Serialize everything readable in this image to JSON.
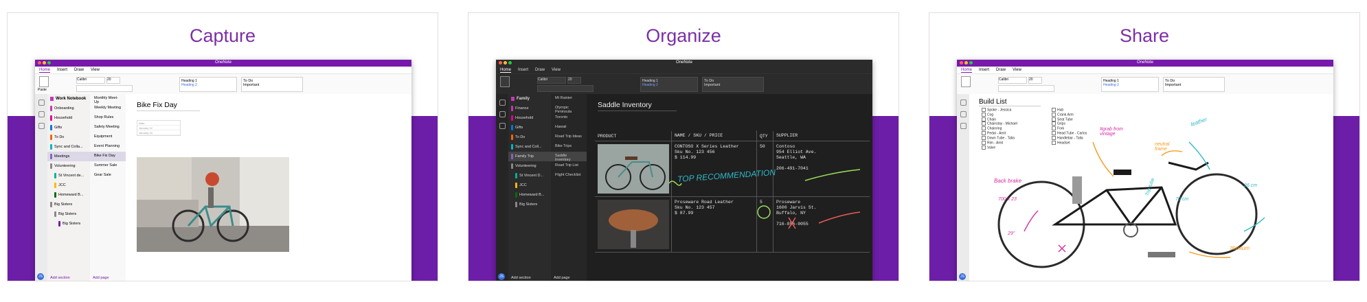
{
  "panels": [
    {
      "title": "Capture"
    },
    {
      "title": "Organize"
    },
    {
      "title": "Share"
    }
  ],
  "app": {
    "window_title": "OneNote",
    "menu": [
      "Home",
      "Insert",
      "Draw",
      "View"
    ],
    "ribbon": {
      "font": "Calibri",
      "size": "20",
      "style1": "Heading 1",
      "style2": "Heading 2",
      "tag1": "To Do",
      "tag2": "Important",
      "paste": "Paste",
      "cut": "Cut",
      "copy": "Copy",
      "format": "Format"
    },
    "add_section": "Add section",
    "add_page": "Add page",
    "avatar": "JS"
  },
  "capture": {
    "notebook": "Work Notebook",
    "sections": [
      "Onboarding",
      "Household",
      "Gifts",
      "To Do",
      "Sync and Colla...",
      "Meetings",
      "Volunteering",
      "St Vincent de...",
      "JCC",
      "Homeward B...",
      "Big Sisters",
      "Big Sisters",
      "Big Sisters"
    ],
    "section_colors": [
      "#c239b3",
      "#e3008c",
      "#0078d4",
      "#f7630c",
      "#00b7c3",
      "#8764b8",
      "#888888",
      "#00b294",
      "#ffb900",
      "#0b6a0b",
      "#888888",
      "#888888",
      "#7719aa"
    ],
    "pages": [
      "Monthly Meet-Up",
      "Weekly Meeting",
      "Shop Rules",
      "Safety Meeting",
      "Equipment",
      "Event Planning",
      "Bike Fix Day",
      "Summer Sale",
      "Gear Sale"
    ],
    "page_title": "Bike Fix Day",
    "mini_table": [
      "Date",
      "January 12",
      "January 15"
    ]
  },
  "organize": {
    "notebook": "Family",
    "sections": [
      "Finance",
      "Household",
      "Gifts",
      "To Do",
      "Sync and Coll...",
      "Family Trip",
      "Volunteering",
      "St Vincent D...",
      "JCC",
      "Homeward B...",
      "Big Sisters"
    ],
    "section_colors": [
      "#c239b3",
      "#e3008c",
      "#0078d4",
      "#f7630c",
      "#00b7c3",
      "#8764b8",
      "#888888",
      "#00b294",
      "#ffb900",
      "#0b6a0b",
      "#888888"
    ],
    "pages": [
      "Mt Rainier",
      "Olympic Peninsula",
      "Toronto",
      "Hawaii",
      "Road Trip Ideas",
      "Bike Trips",
      "Saddle Inventory",
      "Road Trip List",
      "Flight Checklist"
    ],
    "page_title": "Saddle Inventory",
    "table": {
      "headers": [
        "PRODUCT",
        "NAME / SKU / PRICE",
        "QTY",
        "SUPPLIER"
      ],
      "rows": [
        {
          "name": "CONTOSO X Series Leather",
          "sku": "Sku No. 123 456",
          "price": "$ 114.99",
          "qty": "50",
          "supplier": "Contoso",
          "addr1": "954 Elliot Ave.",
          "addr2": "Seattle, WA",
          "phone": "206-491-7041"
        },
        {
          "name": "Proseware Road Leather",
          "sku": "Sku No. 123 457",
          "price": "$ 87.99",
          "qty": "5",
          "supplier": "Proseware",
          "addr1": "1600 Jarvis St.",
          "addr2": "Buffalo, NY",
          "phone": "716-856-0055"
        }
      ],
      "ink": "TOP RECOMMENDATION"
    }
  },
  "share": {
    "page_title": "Build List",
    "list1": [
      "Spoke - Jessica",
      "Cog",
      "Chain",
      "Chainstay - Michael",
      "Chainring",
      "Pedal - Amit",
      "Down Tube - Talia",
      "Rim - Amit",
      "Valve"
    ],
    "list2": [
      "Hub",
      "Crank Arm",
      "Seat Tube",
      "Grips",
      "Fork",
      "Head Tube - Carlos",
      "Handlebar - Talia",
      "Headset"
    ],
    "ink": [
      "Back brake",
      "#grab from vintage",
      "leather",
      "neutral frame",
      "Top tube",
      "titanium",
      "700 x 23",
      "29\"",
      "70 cm",
      "26 cm"
    ]
  },
  "colors": {
    "accent": "#7719aa",
    "band": "#6d1ea8",
    "title": "#7b2fa6",
    "ink_teal": "#2fb8c8",
    "ink_green": "#9be05a",
    "ink_red": "#f05a5a",
    "ink_orange": "#f59a1e",
    "ink_magenta": "#d62ea0"
  }
}
